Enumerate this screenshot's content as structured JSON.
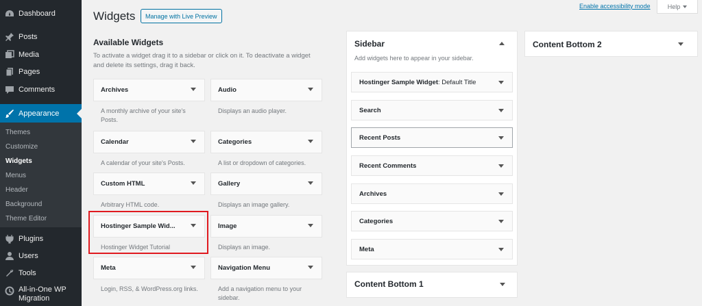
{
  "menu": {
    "dashboard": "Dashboard",
    "posts": "Posts",
    "media": "Media",
    "pages": "Pages",
    "comments": "Comments",
    "appearance": "Appearance",
    "plugins": "Plugins",
    "users": "Users",
    "tools": "Tools",
    "aio_line1": "All-in-One WP",
    "aio_line2": "Migration"
  },
  "submenu": {
    "themes": "Themes",
    "customize": "Customize",
    "widgets": "Widgets",
    "menus": "Menus",
    "header": "Header",
    "background": "Background",
    "theme_editor": "Theme Editor"
  },
  "header": {
    "title": "Widgets",
    "live_preview": "Manage with Live Preview",
    "accessibility": "Enable accessibility mode",
    "help": "Help"
  },
  "available": {
    "title": "Available Widgets",
    "desc_line1": "To activate a widget drag it to a sidebar or click on it. To deactivate a widget",
    "desc_line2": "and delete its settings, drag it back.",
    "widgets": [
      {
        "name": "Archives",
        "desc1": "A monthly archive of your site's",
        "desc2": "Posts."
      },
      {
        "name": "Audio",
        "desc1": "Displays an audio player.",
        "desc2": ""
      },
      {
        "name": "Calendar",
        "desc1": "A calendar of your site's Posts.",
        "desc2": ""
      },
      {
        "name": "Categories",
        "desc1": "A list or dropdown of categories.",
        "desc2": ""
      },
      {
        "name": "Custom HTML",
        "desc1": "Arbitrary HTML code.",
        "desc2": ""
      },
      {
        "name": "Gallery",
        "desc1": "Displays an image gallery.",
        "desc2": ""
      },
      {
        "name": "Hostinger Sample Wid...",
        "desc1": "Hostinger Widget Tutorial",
        "desc2": ""
      },
      {
        "name": "Image",
        "desc1": "Displays an image.",
        "desc2": ""
      },
      {
        "name": "Meta",
        "desc1": "Login, RSS, & WordPress.org links.",
        "desc2": ""
      },
      {
        "name": "Navigation Menu",
        "desc1": "Add a navigation menu to your",
        "desc2": "sidebar."
      }
    ]
  },
  "sidebar": {
    "title": "Sidebar",
    "desc": "Add widgets here to appear in your sidebar.",
    "widgets": [
      {
        "name": "Hostinger Sample Widget",
        "in_title": ": Default Title"
      },
      {
        "name": "Search",
        "in_title": ""
      },
      {
        "name": "Recent Posts",
        "in_title": ""
      },
      {
        "name": "Recent Comments",
        "in_title": ""
      },
      {
        "name": "Archives",
        "in_title": ""
      },
      {
        "name": "Categories",
        "in_title": ""
      },
      {
        "name": "Meta",
        "in_title": ""
      }
    ]
  },
  "content_bottom_1": {
    "title": "Content Bottom 1"
  },
  "content_bottom_2": {
    "title": "Content Bottom 2"
  },
  "colors": {
    "sidebar_bg": "#23282d",
    "submenu_bg": "#32373c",
    "accent": "#0073aa",
    "highlight": "#e0191f"
  }
}
